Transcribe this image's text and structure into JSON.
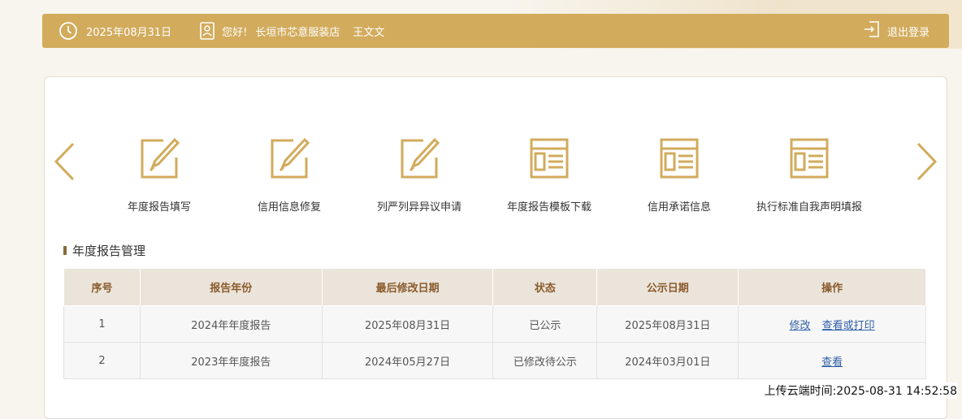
{
  "header": {
    "date": "2025年08月31日",
    "greeting": "您好!",
    "shop": "长垣市芯意服装店",
    "user": "王文文",
    "logout": "退出登录"
  },
  "functions": [
    {
      "label": "年度报告填写",
      "icon": "edit-icon"
    },
    {
      "label": "信用信息修复",
      "icon": "edit-icon"
    },
    {
      "label": "列严列异异议申请",
      "icon": "edit-icon"
    },
    {
      "label": "年度报告模板下载",
      "icon": "template-icon"
    },
    {
      "label": "信用承诺信息",
      "icon": "template-icon"
    },
    {
      "label": "执行标准自我声明填报",
      "icon": "template-icon"
    }
  ],
  "section": {
    "title": "年度报告管理"
  },
  "table": {
    "headers": [
      "序号",
      "报告年份",
      "最后修改日期",
      "状态",
      "公示日期",
      "操作"
    ],
    "rows": [
      {
        "no": "1",
        "year": "2024年年度报告",
        "modified": "2025年08月31日",
        "status": "已公示",
        "published": "2025年08月31日",
        "actions": [
          "修改",
          "查看或打印"
        ]
      },
      {
        "no": "2",
        "year": "2023年年度报告",
        "modified": "2024年05月27日",
        "status": "已修改待公示",
        "published": "2024年03月01日",
        "actions": [
          "查看"
        ]
      }
    ]
  },
  "upload": {
    "label": "上传云端时间:",
    "time": "2025-08-31 14:52:58"
  },
  "colors": {
    "accent": "#d2ab5c",
    "header_text": "#8a5a2b",
    "link": "#2f5fa8"
  }
}
